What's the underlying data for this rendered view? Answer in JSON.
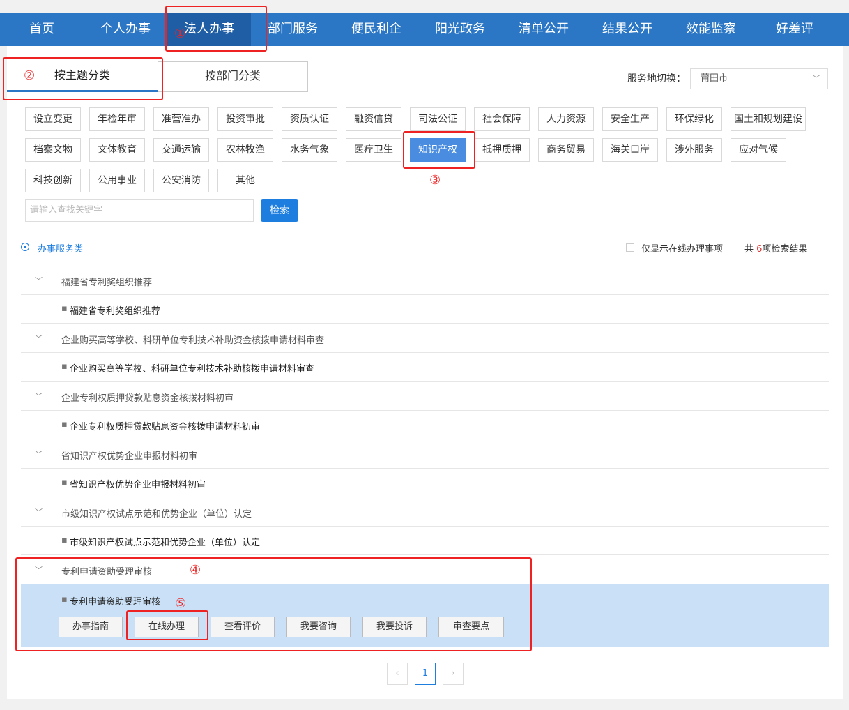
{
  "nav": [
    "首页",
    "个人办事",
    "法人办事",
    "部门服务",
    "便民利企",
    "阳光政务",
    "清单公开",
    "结果公开",
    "效能监察",
    "好差评"
  ],
  "tabs": {
    "by_theme": "按主题分类",
    "by_dept": "按部门分类"
  },
  "service_area": {
    "label": "服务地切换：",
    "value": "莆田市"
  },
  "categories": [
    "设立变更",
    "年检年审",
    "准营准办",
    "投资审批",
    "资质认证",
    "融资信贷",
    "司法公证",
    "社会保障",
    "人力资源",
    "安全生产",
    "环保绿化",
    "国土和规划建设",
    "档案文物",
    "文体教育",
    "交通运输",
    "农林牧渔",
    "水务气象",
    "医疗卫生",
    "知识产权",
    "抵押质押",
    "商务贸易",
    "海关口岸",
    "涉外服务",
    "应对气候",
    "科技创新",
    "公用事业",
    "公安消防",
    "其他"
  ],
  "search": {
    "placeholder": "请输入查找关键字",
    "button": "检索"
  },
  "filter": {
    "radio_label": "办事服务类",
    "checkbox_label": "仅显示在线办理事项",
    "count_prefix": "共 ",
    "count_num": "6",
    "count_suffix": "项检索结果"
  },
  "groups": [
    {
      "title": "福建省专利奖组织推荐",
      "item": "福建省专利奖组织推荐"
    },
    {
      "title": "企业购买高等学校、科研单位专利技术补助资金核拨申请材料审查",
      "item": "企业购买高等学校、科研单位专利技术补助核拨申请材料审查"
    },
    {
      "title": "企业专利权质押贷款贴息资金核拨材料初审",
      "item": "企业专利权质押贷款贴息资金核拨申请材料初审"
    },
    {
      "title": "省知识产权优势企业申报材料初审",
      "item": "省知识产权优势企业申报材料初审"
    },
    {
      "title": "市级知识产权试点示范和优势企业（单位）认定",
      "item": "市级知识产权试点示范和优势企业（单位）认定"
    },
    {
      "title": "专利申请资助受理审核",
      "item": "专利申请资助受理审核"
    }
  ],
  "actions": [
    "办事指南",
    "在线办理",
    "查看评价",
    "我要咨询",
    "我要投诉",
    "审查要点"
  ],
  "pagination": {
    "prev": "‹",
    "page": "1",
    "next": "›"
  },
  "annotations": [
    "①",
    "②",
    "③",
    "④",
    "⑤"
  ]
}
